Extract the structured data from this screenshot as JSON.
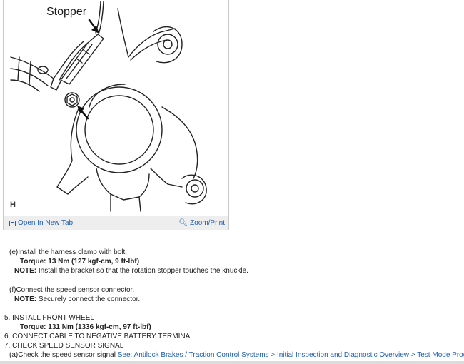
{
  "figure": {
    "callout": "Stopper",
    "letter": "H",
    "open_tab_label": "Open In New Tab",
    "zoom_label": "Zoom/Print",
    "open_tab_icon": "open-new-tab-icon",
    "zoom_icon": "magnifier-icon"
  },
  "steps": {
    "e_text": "(e)Install the harness clamp with bolt.",
    "e_torque": "Torque: 13 Nm (127 kgf-cm, 9 ft-lbf)",
    "e_note_label": "NOTE:",
    "e_note_text": " Install the bracket so that the rotation stopper touches the knuckle.",
    "f_text": "(f)Connect the speed sensor connector.",
    "f_note_label": "NOTE:",
    "f_note_text": " Securely connect the connector.",
    "s5": "5. INSTALL FRONT WHEEL",
    "s5_torque": "Torque: 131 Nm (1336 kgf-cm, 97 ft-lbf)",
    "s6": "6. CONNECT CABLE TO NEGATIVE BATTERY TERMINAL",
    "s7": "7. CHECK SPEED SENSOR SIGNAL",
    "a_prefix": "(a)Check the speed sensor signal ",
    "a_link_see": "See: ",
    "a_link_1": "Antilock Brakes / Traction Control Systems",
    "a_link_sep1": " > ",
    "a_link_2": "Initial Inspection and Diagnostic Overview",
    "a_link_sep2": " > ",
    "a_link_3": "Test Mode Procedure",
    "a_suffix": "."
  },
  "colors": {
    "link": "#1f5fb0",
    "toolbar": "#eeeeee"
  }
}
